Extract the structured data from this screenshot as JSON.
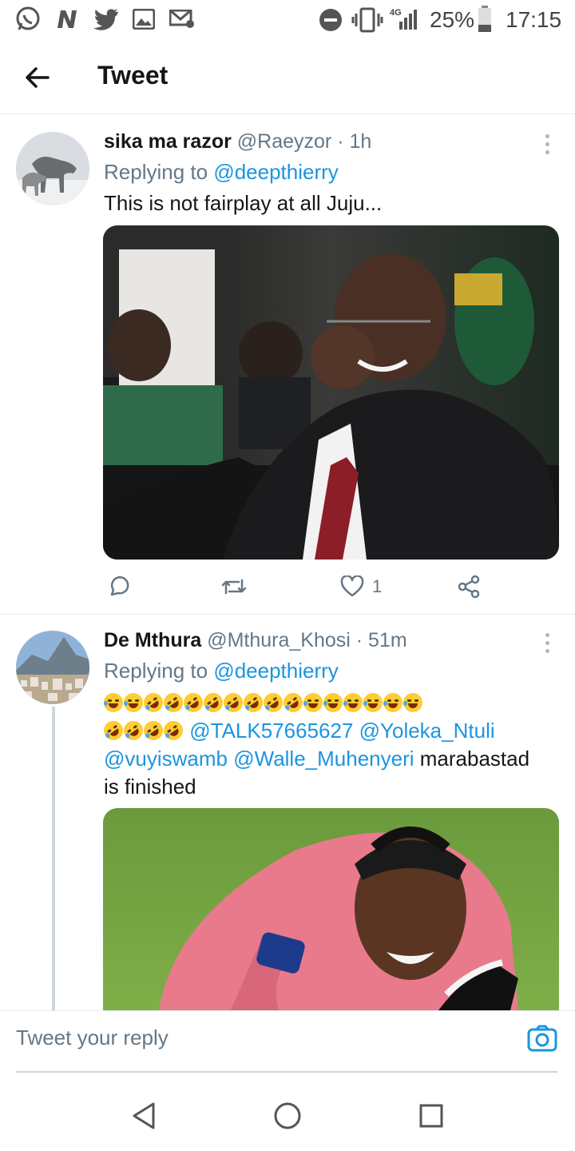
{
  "status_bar": {
    "battery": "25%",
    "network": "4G",
    "time": "17:15",
    "icons": [
      "whatsapp-icon",
      "news-icon",
      "twitter-icon",
      "gallery-icon",
      "mail-icon",
      "dnd-icon",
      "vibrate-icon",
      "signal-icon",
      "battery-icon"
    ]
  },
  "header": {
    "title": "Tweet",
    "back_icon": "arrow-left-icon"
  },
  "tweets": [
    {
      "name": "sika ma razor",
      "handle": "@Raeyzor",
      "time": "· 1h",
      "replying_prefix": "Replying to ",
      "replying_handle": "@deepthierry",
      "text": "This is not fairplay at all Juju...",
      "likes": "1"
    },
    {
      "name": "De Mthura",
      "handle": "@Mthura_Khosi",
      "time": "· 51m",
      "replying_prefix": "Replying to ",
      "replying_handle": "@deepthierry",
      "mentions": [
        "@TALK57665627",
        "@Yoleka_Ntuli",
        "@vuyiswamb",
        "@Walle_Muhenyeri"
      ],
      "text_tail": "marabastad",
      "text_end": "is finished"
    }
  ],
  "reply_bar": {
    "placeholder": "Tweet your reply"
  },
  "colors": {
    "accent": "#1b95e0",
    "muted": "#657786",
    "text": "#14171a"
  }
}
